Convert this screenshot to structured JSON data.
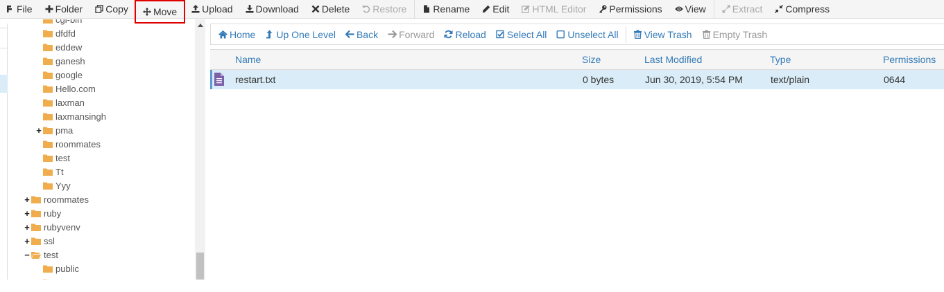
{
  "toolbar": {
    "items": [
      {
        "label": "File",
        "icon": "plus-file-icon",
        "disabled": false
      },
      {
        "label": "Folder",
        "icon": "plus-icon",
        "disabled": false
      },
      {
        "label": "Copy",
        "icon": "copy-icon",
        "disabled": false
      },
      {
        "label": "Move",
        "icon": "move-icon",
        "disabled": false,
        "highlighted": true
      },
      {
        "label": "Upload",
        "icon": "upload-icon",
        "disabled": false
      },
      {
        "label": "Download",
        "icon": "download-icon",
        "disabled": false
      },
      {
        "label": "Delete",
        "icon": "x-icon",
        "disabled": false
      },
      {
        "label": "Restore",
        "icon": "undo-icon",
        "disabled": true
      },
      {
        "label": "Rename",
        "icon": "document-icon",
        "disabled": false
      },
      {
        "label": "Edit",
        "icon": "pencil-icon",
        "disabled": false
      },
      {
        "label": "HTML Editor",
        "icon": "pencil-square-icon",
        "disabled": true
      },
      {
        "label": "Permissions",
        "icon": "key-icon",
        "disabled": false
      },
      {
        "label": "View",
        "icon": "eye-icon",
        "disabled": false
      },
      {
        "label": "Extract",
        "icon": "expand-icon",
        "disabled": true
      },
      {
        "label": "Compress",
        "icon": "compress-icon",
        "disabled": false
      }
    ],
    "highlight_color": "#e00000"
  },
  "tree": {
    "items": [
      {
        "label": "cgi-bin",
        "indent": 2,
        "expander": ""
      },
      {
        "label": "dfdfd",
        "indent": 2,
        "expander": ""
      },
      {
        "label": "eddew",
        "indent": 2,
        "expander": ""
      },
      {
        "label": "ganesh",
        "indent": 2,
        "expander": ""
      },
      {
        "label": "google",
        "indent": 2,
        "expander": ""
      },
      {
        "label": "Hello.com",
        "indent": 2,
        "expander": ""
      },
      {
        "label": "laxman",
        "indent": 2,
        "expander": ""
      },
      {
        "label": "laxmansingh",
        "indent": 2,
        "expander": ""
      },
      {
        "label": "pma",
        "indent": 2,
        "expander": "+"
      },
      {
        "label": "roommates",
        "indent": 2,
        "expander": ""
      },
      {
        "label": "test",
        "indent": 2,
        "expander": ""
      },
      {
        "label": "Tt",
        "indent": 2,
        "expander": ""
      },
      {
        "label": "Yyy",
        "indent": 2,
        "expander": ""
      },
      {
        "label": "roommates",
        "indent": 1,
        "expander": "+"
      },
      {
        "label": "ruby",
        "indent": 1,
        "expander": "+"
      },
      {
        "label": "rubyvenv",
        "indent": 1,
        "expander": "+"
      },
      {
        "label": "ssl",
        "indent": 1,
        "expander": "+"
      },
      {
        "label": "test",
        "indent": 1,
        "expander": "−",
        "open": true
      },
      {
        "label": "public",
        "indent": 2,
        "expander": ""
      },
      {
        "label": "",
        "indent": 2,
        "expander": ""
      }
    ],
    "folder_color": "#f0ad4e"
  },
  "nav": {
    "items": [
      {
        "label": "Home",
        "icon": "home-icon",
        "disabled": false
      },
      {
        "label": "Up One Level",
        "icon": "level-up-icon",
        "disabled": false
      },
      {
        "label": "Back",
        "icon": "arrow-left-icon",
        "disabled": false
      },
      {
        "label": "Forward",
        "icon": "arrow-right-icon",
        "disabled": true
      },
      {
        "label": "Reload",
        "icon": "refresh-icon",
        "disabled": false
      },
      {
        "label": "Select All",
        "icon": "checkbox-checked-icon",
        "disabled": false
      },
      {
        "label": "Unselect All",
        "icon": "checkbox-empty-icon",
        "disabled": false
      },
      {
        "label": "View Trash",
        "icon": "trash-icon",
        "disabled": false
      },
      {
        "label": "Empty Trash",
        "icon": "trash-icon",
        "disabled": true
      }
    ]
  },
  "table": {
    "columns": [
      "Name",
      "Size",
      "Last Modified",
      "Type",
      "Permissions"
    ],
    "rows": [
      {
        "name": "restart.txt",
        "size": "0 bytes",
        "modified": "Jun 30, 2019, 5:54 PM",
        "type": "text/plain",
        "perms": "0644",
        "icon": "text-file-icon"
      }
    ],
    "file_icon_color": "#7b61a8",
    "selected_row_color": "#d9ecf7"
  }
}
